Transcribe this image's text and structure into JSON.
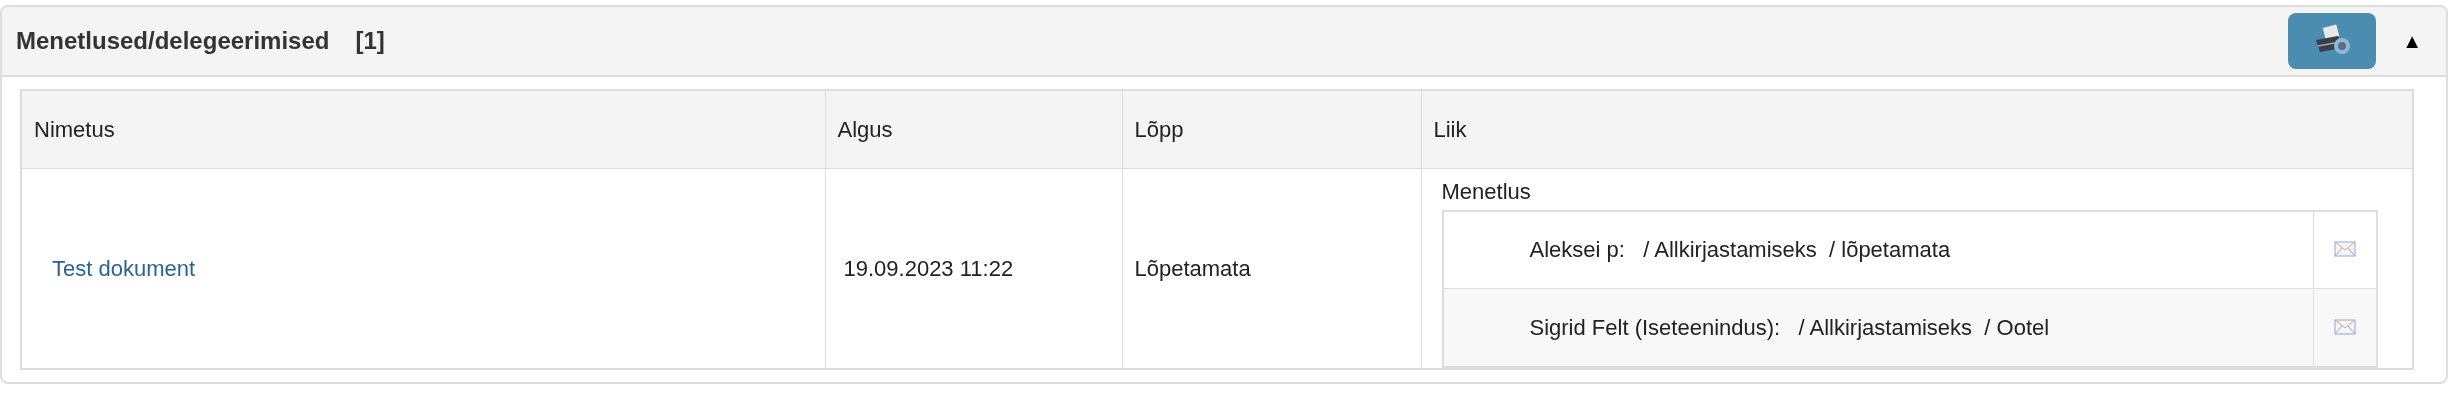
{
  "panel": {
    "title": "Menetlused/delegeerimised",
    "count": "[1]",
    "expanded": true,
    "collapse_glyph": "▲"
  },
  "table": {
    "columns": [
      "Nimetus",
      "Algus",
      "Lõpp",
      "Liik"
    ],
    "rows": [
      {
        "name": "Test dokument",
        "start": "19.09.2023 11:22",
        "end": "Lõpetamata",
        "type_label": "Menetlus",
        "steps": [
          {
            "text": "Aleksei p:   / Allkirjastamiseks  / lõpetamata"
          },
          {
            "text": "Sigrid Felt (Iseteenindus):   / Allkirjastamiseks  / Ootel"
          }
        ]
      }
    ]
  }
}
